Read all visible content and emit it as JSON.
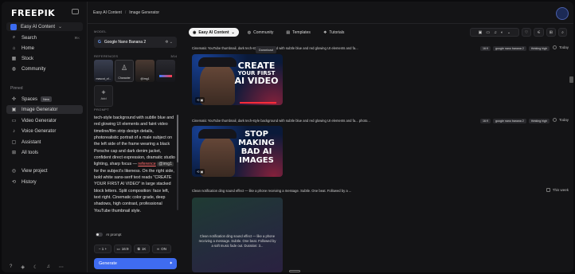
{
  "app": {
    "logo": "FREEPIK"
  },
  "sidebar": {
    "brand": "Easy AI Content",
    "brand_chevron": "⌄",
    "items": [
      {
        "label": "Search",
        "icon": "search-icon",
        "glyph": "⌕",
        "kbd": "⌘K"
      },
      {
        "label": "Home",
        "icon": "home-icon",
        "glyph": "⌂"
      },
      {
        "label": "Stock",
        "icon": "stock-icon",
        "glyph": "▦"
      },
      {
        "label": "Community",
        "icon": "community-icon",
        "glyph": "◍"
      }
    ],
    "pinned_label": "Pinned",
    "pinned": [
      {
        "label": "Spaces",
        "icon": "spaces-icon",
        "glyph": "✣",
        "badge": "New"
      },
      {
        "label": "Image Generator",
        "icon": "image-icon",
        "glyph": "▣"
      },
      {
        "label": "Video Generator",
        "icon": "video-icon",
        "glyph": "▭"
      },
      {
        "label": "Voice Generator",
        "icon": "voice-icon",
        "glyph": "♪"
      },
      {
        "label": "Assistant",
        "icon": "assistant-icon",
        "glyph": "▢"
      },
      {
        "label": "All tools",
        "icon": "grid-icon",
        "glyph": "⊞"
      }
    ],
    "bottom": [
      {
        "label": "View project",
        "icon": "project-icon",
        "glyph": "◎"
      },
      {
        "label": "History",
        "icon": "history-icon",
        "glyph": "⟲"
      }
    ],
    "footer_icons": [
      "?",
      "◈",
      "☾",
      "♫",
      "⋯"
    ]
  },
  "topbar": {
    "crumb1": "Easy AI Content",
    "crumb2": "Image Generator",
    "separator": "/"
  },
  "panel": {
    "model_label": "MODEL",
    "model": "Google Nano Banana 2",
    "model_icon": "G",
    "references_label": "REFERENCES",
    "references_count": "3/14",
    "refs": [
      {
        "caption": "mascot_of..."
      },
      {
        "caption": "Character"
      },
      {
        "caption": "@img1"
      },
      {
        "caption": ""
      }
    ],
    "add_label": "Add",
    "prompt_label": "PROMPT",
    "prompt_before": "tech-style background with subtle blue and red glowing UI elements and faint video timeline/film strip design details, photorealistic portrait of a male subject on the left side of the frame wearing a black Porsche cap and dark denim jacket, confident direct expression, dramatic studio lighting, sharp focus — ",
    "prompt_ref": "reference",
    "prompt_chip": "@img1",
    "prompt_after": " for the subject's likeness. On the right side, bold white sans-serif text reads \"CREATE YOUR FIRST AI VIDEO\" in large stacked block letters. Split composition: face left, text right. Cinematic color grade, deep shadows, high contrast, professional YouTube thumbnail style.",
    "ai_prompt": "AI prompt",
    "controls": {
      "count": "1",
      "ratio": "16:9",
      "res": "1K",
      "toggle": "ON"
    },
    "generate": "Generate"
  },
  "main": {
    "tabs": [
      {
        "label": "Easy AI Content",
        "active": true,
        "glyph": "◉"
      },
      {
        "label": "Community",
        "glyph": "◍"
      },
      {
        "label": "Templates",
        "glyph": "▤"
      },
      {
        "label": "Tutorials",
        "glyph": "❖"
      }
    ],
    "rows": [
      {
        "title": "Cinematic YouTube thumbnail, dark tech-style background with subtle blue and red glowing UI elements and fa...",
        "tags": [
          "16:9",
          "google nano banana 2",
          "thinking high"
        ],
        "time": "Today",
        "thumb_lines": [
          "CREATE",
          "YOUR FIRST",
          "AI VIDEO"
        ],
        "tooltip": "Download"
      },
      {
        "title": "Cinematic YouTube thumbnail, dark tech-style background with subtle blue and red glowing UI elements and fa... photo...",
        "tags": [
          "16:9",
          "google nano banana 2",
          "thinking high"
        ],
        "time": "Today",
        "thumb_lines": [
          "STOP",
          "MAKING",
          "BAD AI",
          "IMAGES"
        ]
      },
      {
        "title": "Clean notification ding sound effect — like a phone receiving a message. Subtle. One beat. Followed by a ...",
        "time": "This week",
        "card_text": "Clean notification ding sound effect — like a phone receiving a message. Subtle. One beat. Followed by a soft music fade out. Duration: 3..."
      }
    ]
  }
}
